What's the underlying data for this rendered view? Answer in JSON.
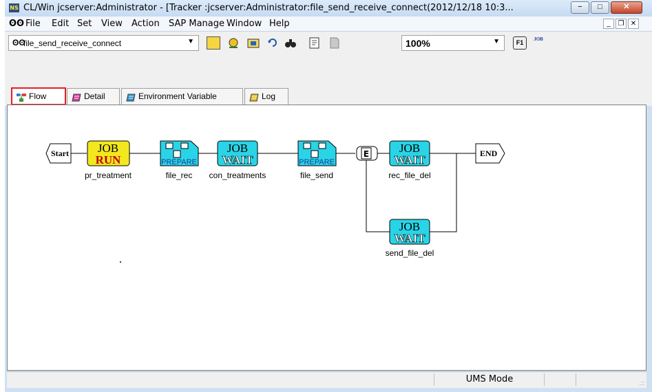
{
  "window": {
    "title": "CL/Win jcserver:Administrator - [Tracker :jcserver:Administrator:file_send_receive_connect(2012/12/18 10:3...",
    "app_icon_text": "NS",
    "min_label": "−",
    "max_label": "□",
    "close_label": "✕"
  },
  "menubar": {
    "doc_icon": "ʘʘ",
    "items": [
      "File",
      "Edit",
      "Set",
      "View",
      "Action",
      "SAP Manage",
      "Window",
      "Help"
    ],
    "mdi_min": "_",
    "mdi_restore": "❐",
    "mdi_close": "✕"
  },
  "toolbar": {
    "combo_icon": "ʘʘ",
    "combo_value": "file_send_receive_connect",
    "zoom_value": "100%",
    "dropdown_glyph": "▼",
    "icons": [
      {
        "name": "tracker-icon",
        "glyph": "📊"
      },
      {
        "name": "monitor-icon",
        "glyph": "👁"
      },
      {
        "name": "folder-icon",
        "glyph": "📁"
      },
      {
        "name": "refresh-icon",
        "glyph": "↻"
      },
      {
        "name": "find-icon",
        "glyph": "🔍"
      },
      {
        "name": "print-preview-icon",
        "glyph": "📄"
      },
      {
        "name": "document-icon",
        "glyph": "■"
      },
      {
        "name": "help-f1-icon",
        "glyph": "F1"
      },
      {
        "name": "job-icon",
        "glyph": "JOB"
      }
    ]
  },
  "tabs": [
    {
      "label": "Flow",
      "active": true,
      "color": "#3a7bd5"
    },
    {
      "label": "Detail",
      "active": false,
      "color": "#c0309a"
    },
    {
      "label": "Environment Variable",
      "active": false,
      "color": "#2b8fc9"
    },
    {
      "label": "Log",
      "active": false,
      "color": "#d6a400"
    }
  ],
  "flow": {
    "start_label": "Start",
    "end_label": "END",
    "nodes": [
      {
        "id": "pr_treatment",
        "label": "pr_treatment",
        "line1": "JOB",
        "line2": "RUN",
        "kind": "run"
      },
      {
        "id": "file_rec",
        "label": "file_rec",
        "line1": "",
        "line2": "PREPARE",
        "kind": "prepare"
      },
      {
        "id": "con_treatments",
        "label": "con_treatments",
        "line1": "JOB",
        "line2": "WAIT",
        "kind": "wait"
      },
      {
        "id": "file_send",
        "label": "file_send",
        "line1": "",
        "line2": "PREPARE",
        "kind": "prepare"
      },
      {
        "id": "rec_file_del",
        "label": "rec_file_del",
        "line1": "JOB",
        "line2": "WAIT",
        "kind": "wait"
      },
      {
        "id": "send_file_del",
        "label": "send_file_del",
        "line1": "JOB",
        "line2": "WAIT",
        "kind": "wait"
      }
    ],
    "branch_glyph": "E"
  },
  "statusbar": {
    "mode": "UMS Mode",
    "grip": ".::"
  },
  "colors": {
    "run_fill": "#f3e71f",
    "run_text_bottom": "#c00000",
    "wait_fill": "#29d4e6",
    "prepare_fill": "#29d4e6",
    "active_tab_outline": "#e02020"
  }
}
